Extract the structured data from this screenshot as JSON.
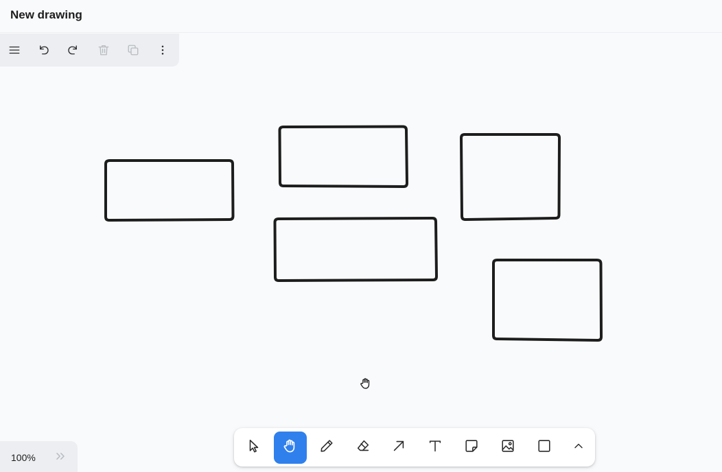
{
  "window": {
    "title": "New drawing"
  },
  "top_toolbar": {
    "items": [
      {
        "icon": "menu-icon"
      },
      {
        "icon": "undo-icon"
      },
      {
        "icon": "redo-icon"
      },
      {
        "icon": "trash-icon",
        "disabled": true
      },
      {
        "icon": "duplicate-icon",
        "disabled": true
      },
      {
        "icon": "more-vertical-icon"
      }
    ]
  },
  "canvas": {
    "shapes": [
      {
        "type": "rectangle"
      },
      {
        "type": "rectangle"
      },
      {
        "type": "rectangle"
      },
      {
        "type": "rectangle"
      },
      {
        "type": "rectangle"
      }
    ],
    "stroke_color": "#1d1d1d",
    "background": "#f9fafc"
  },
  "zoom": {
    "value": "100%"
  },
  "tools": {
    "active": "hand",
    "accent_color": "#2f80ed",
    "items": [
      {
        "id": "select",
        "icon": "pointer-icon"
      },
      {
        "id": "hand",
        "icon": "hand-icon"
      },
      {
        "id": "draw",
        "icon": "pencil-icon"
      },
      {
        "id": "eraser",
        "icon": "eraser-icon"
      },
      {
        "id": "arrow",
        "icon": "arrow-icon"
      },
      {
        "id": "text",
        "icon": "text-icon"
      },
      {
        "id": "note",
        "icon": "sticky-note-icon"
      },
      {
        "id": "media",
        "icon": "image-icon"
      },
      {
        "id": "rectangle",
        "icon": "rectangle-icon"
      },
      {
        "id": "more",
        "icon": "chevron-up-icon"
      }
    ]
  }
}
